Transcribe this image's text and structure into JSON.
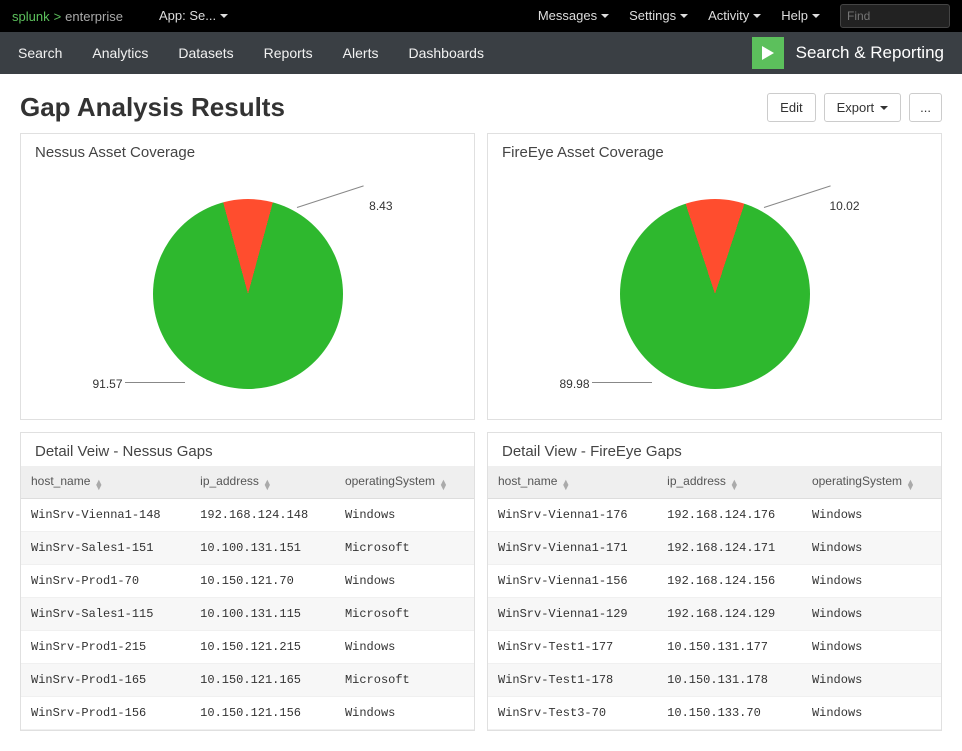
{
  "brand": {
    "prefix": "splunk",
    "suffix": "enterprise"
  },
  "topnav": {
    "app_switcher": "App: Se...",
    "messages": "Messages",
    "settings": "Settings",
    "activity": "Activity",
    "help": "Help",
    "search_placeholder": "Find"
  },
  "subnav": {
    "items": [
      "Search",
      "Analytics",
      "Datasets",
      "Reports",
      "Alerts",
      "Dashboards"
    ],
    "app_name": "Search & Reporting"
  },
  "page": {
    "title": "Gap Analysis Results"
  },
  "actions": {
    "edit": "Edit",
    "export": "Export",
    "more": "..."
  },
  "chart_data": [
    {
      "type": "pie",
      "title": "Nessus Asset Coverage",
      "slices": [
        {
          "label": "91.57",
          "value": 91.57,
          "color": "#2eb82e"
        },
        {
          "label": "8.43",
          "value": 8.43,
          "color": "#ff4d2e"
        }
      ]
    },
    {
      "type": "pie",
      "title": "FireEye Asset Coverage",
      "slices": [
        {
          "label": "89.98",
          "value": 89.98,
          "color": "#2eb82e"
        },
        {
          "label": "10.02",
          "value": 10.02,
          "color": "#ff4d2e"
        }
      ]
    }
  ],
  "tables": [
    {
      "title": "Detail Veiw - Nessus Gaps",
      "columns": [
        "host_name",
        "ip_address",
        "operatingSystem"
      ],
      "rows": [
        [
          "WinSrv-Vienna1-148",
          "192.168.124.148",
          "Windows"
        ],
        [
          "WinSrv-Sales1-151",
          "10.100.131.151",
          "Microsoft"
        ],
        [
          "WinSrv-Prod1-70",
          "10.150.121.70",
          "Windows"
        ],
        [
          "WinSrv-Sales1-115",
          "10.100.131.115",
          "Microsoft"
        ],
        [
          "WinSrv-Prod1-215",
          "10.150.121.215",
          "Windows"
        ],
        [
          "WinSrv-Prod1-165",
          "10.150.121.165",
          "Microsoft"
        ],
        [
          "WinSrv-Prod1-156",
          "10.150.121.156",
          "Windows"
        ]
      ]
    },
    {
      "title": "Detail View - FireEye Gaps",
      "columns": [
        "host_name",
        "ip_address",
        "operatingSystem"
      ],
      "rows": [
        [
          "WinSrv-Vienna1-176",
          "192.168.124.176",
          "Windows"
        ],
        [
          "WinSrv-Vienna1-171",
          "192.168.124.171",
          "Windows"
        ],
        [
          "WinSrv-Vienna1-156",
          "192.168.124.156",
          "Windows"
        ],
        [
          "WinSrv-Vienna1-129",
          "192.168.124.129",
          "Windows"
        ],
        [
          "WinSrv-Test1-177",
          "10.150.131.177",
          "Windows"
        ],
        [
          "WinSrv-Test1-178",
          "10.150.131.178",
          "Windows"
        ],
        [
          "WinSrv-Test3-70",
          "10.150.133.70",
          "Windows"
        ]
      ]
    }
  ]
}
